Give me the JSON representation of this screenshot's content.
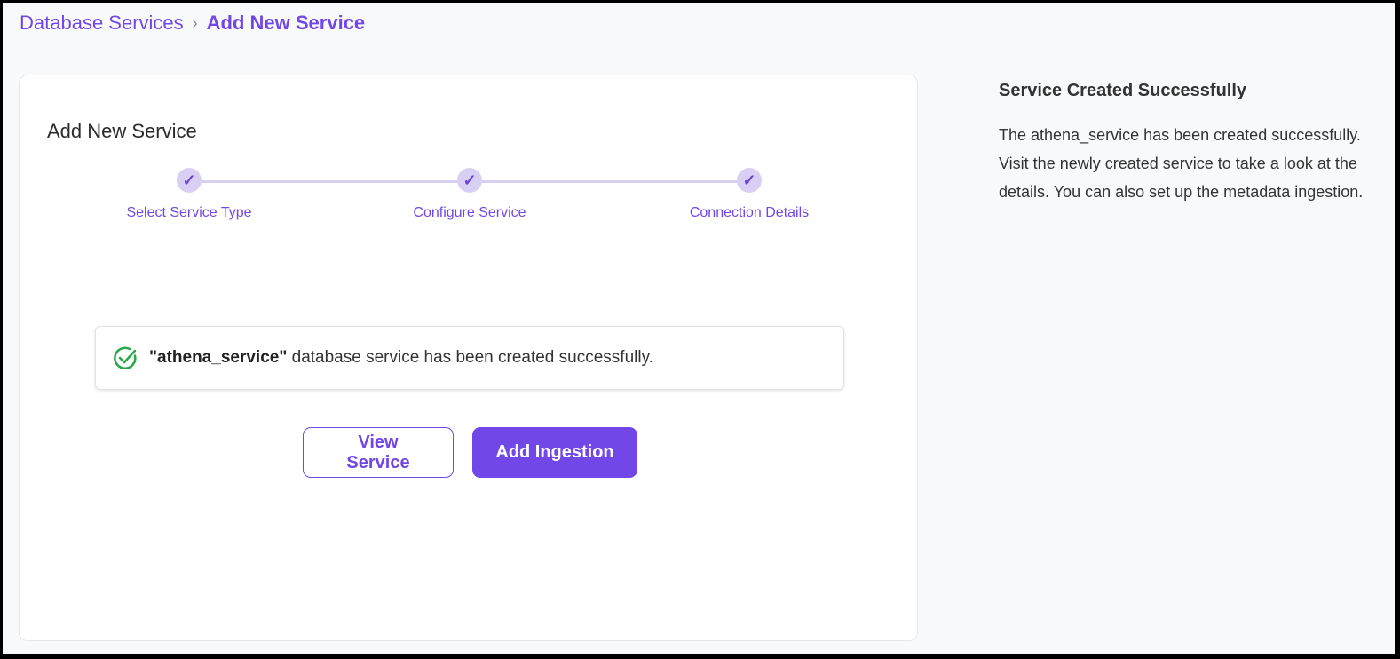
{
  "breadcrumb": {
    "items": [
      "Database Services",
      "Add New Service"
    ]
  },
  "card": {
    "title": "Add New Service",
    "steps": [
      {
        "label": "Select Service Type",
        "done": true
      },
      {
        "label": "Configure Service",
        "done": true
      },
      {
        "label": "Connection Details",
        "done": true
      }
    ],
    "message": {
      "service_name": "\"athena_service\"",
      "text": " database service has been created successfully.",
      "icon": "check-circle-icon",
      "icon_color": "#28a745"
    },
    "buttons": {
      "view": "View Service",
      "add": "Add Ingestion"
    }
  },
  "side": {
    "title": "Service Created Successfully",
    "body": "The athena_service has been created successfully. Visit the newly created service to take a look at the details. You can also set up the metadata ingestion."
  },
  "colors": {
    "accent": "#7147e8"
  }
}
